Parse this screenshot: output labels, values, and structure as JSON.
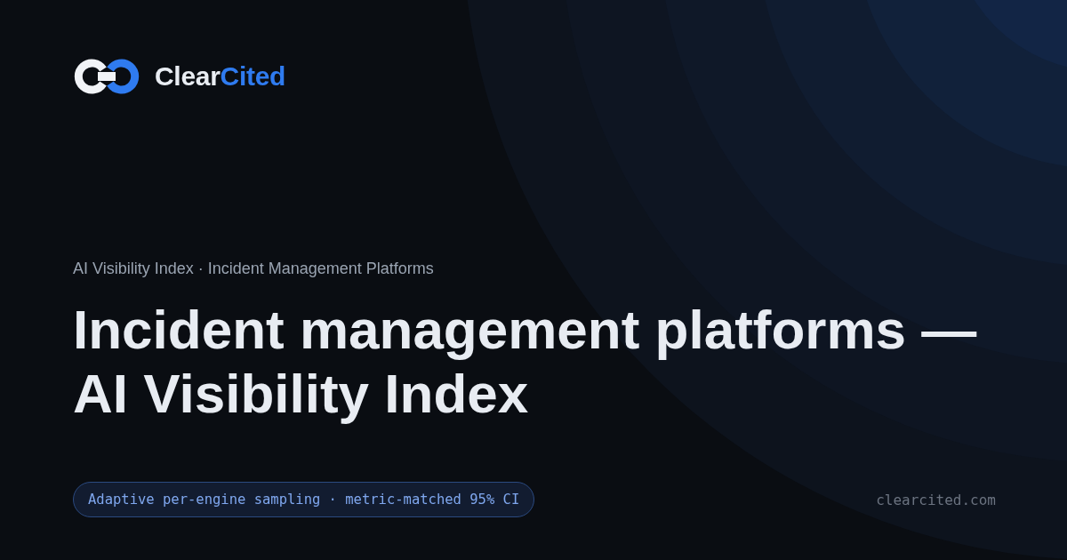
{
  "brand": {
    "first": "Clear",
    "second": "Cited"
  },
  "breadcrumb": "AI Visibility Index · Incident Management Platforms",
  "title": "Incident management platforms — AI Visibility Index",
  "method_badge": "Adaptive per-engine sampling · metric-matched 95% CI",
  "domain": "clearcited.com"
}
